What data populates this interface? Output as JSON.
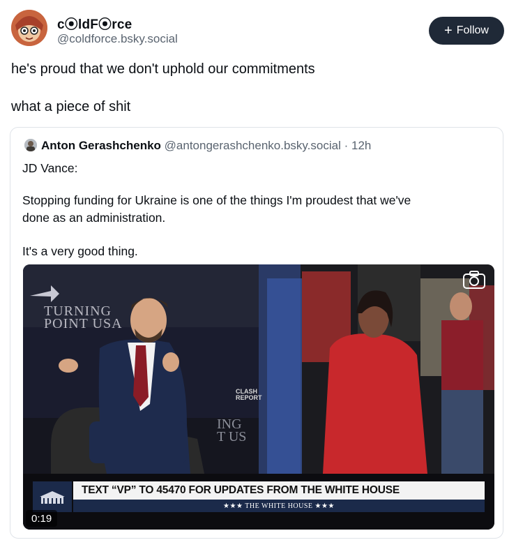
{
  "author": {
    "display_name": "c⦿ldF⦿rce",
    "handle": "@coldforce.bsky.social",
    "avatar_icon": "avatar-image"
  },
  "follow_button": {
    "label": "Follow",
    "icon": "plus-icon"
  },
  "post": {
    "line1": "he's proud that we don't uphold our commitments",
    "line2": "what a piece of shit"
  },
  "quoted_post": {
    "author_name": "Anton Gerashchenko",
    "author_handle": "@antongerashchenko.bsky.social",
    "separator": "·",
    "time": "12h",
    "lines": [
      "JD Vance:",
      "Stopping funding for Ukraine is one of the things I'm proudest that we've",
      "done as an administration.",
      "It's a very good thing."
    ]
  },
  "video": {
    "duration": "0:19",
    "caption": "TEXT “VP” TO 45470 FOR UPDATES FROM THE WHITE HOUSE",
    "footer": "★★★  THE WHITE HOUSE  ★★★",
    "backdrop_text": "TURNING POINT USA",
    "backdrop_fragment": "ING T US",
    "watermark": "CLASH REPORT",
    "icons": [
      "camera-icon"
    ]
  }
}
